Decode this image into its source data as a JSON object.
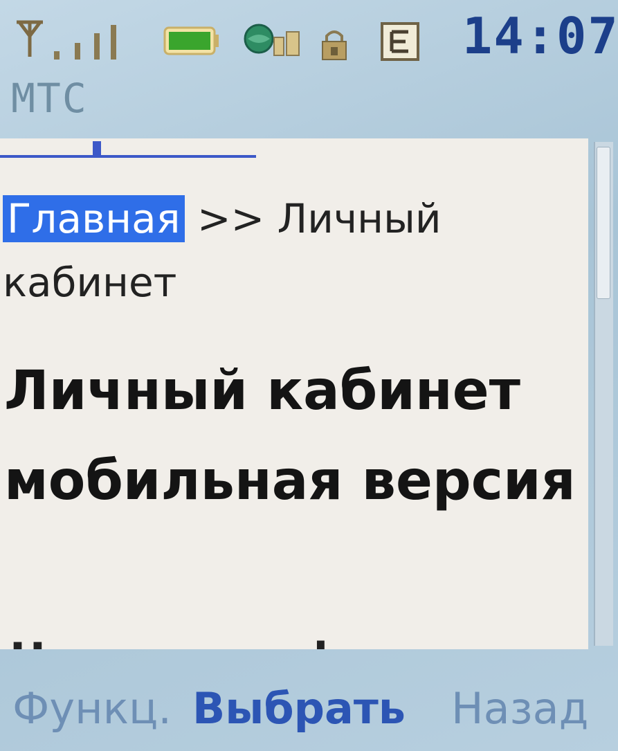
{
  "status_bar": {
    "time": "14:07",
    "operator": "МТС",
    "icons": [
      "signal-antenna-icon",
      "battery-icon",
      "browser-globe-icon",
      "lock-icon",
      "edge-network-icon"
    ]
  },
  "breadcrumb": {
    "home_link": "Главная",
    "separator": ">>",
    "current": "Личный кабинет"
  },
  "page": {
    "heading": "Личный кабинет мобильная версия",
    "next_line_partial": "Номер телефона"
  },
  "softkeys": {
    "left": "Функц.",
    "center": "Выбрать",
    "right": "Назад"
  },
  "colors": {
    "highlight": "#2f6ee8",
    "clock": "#1c3f8a",
    "softkey_active": "#2c55b4"
  }
}
